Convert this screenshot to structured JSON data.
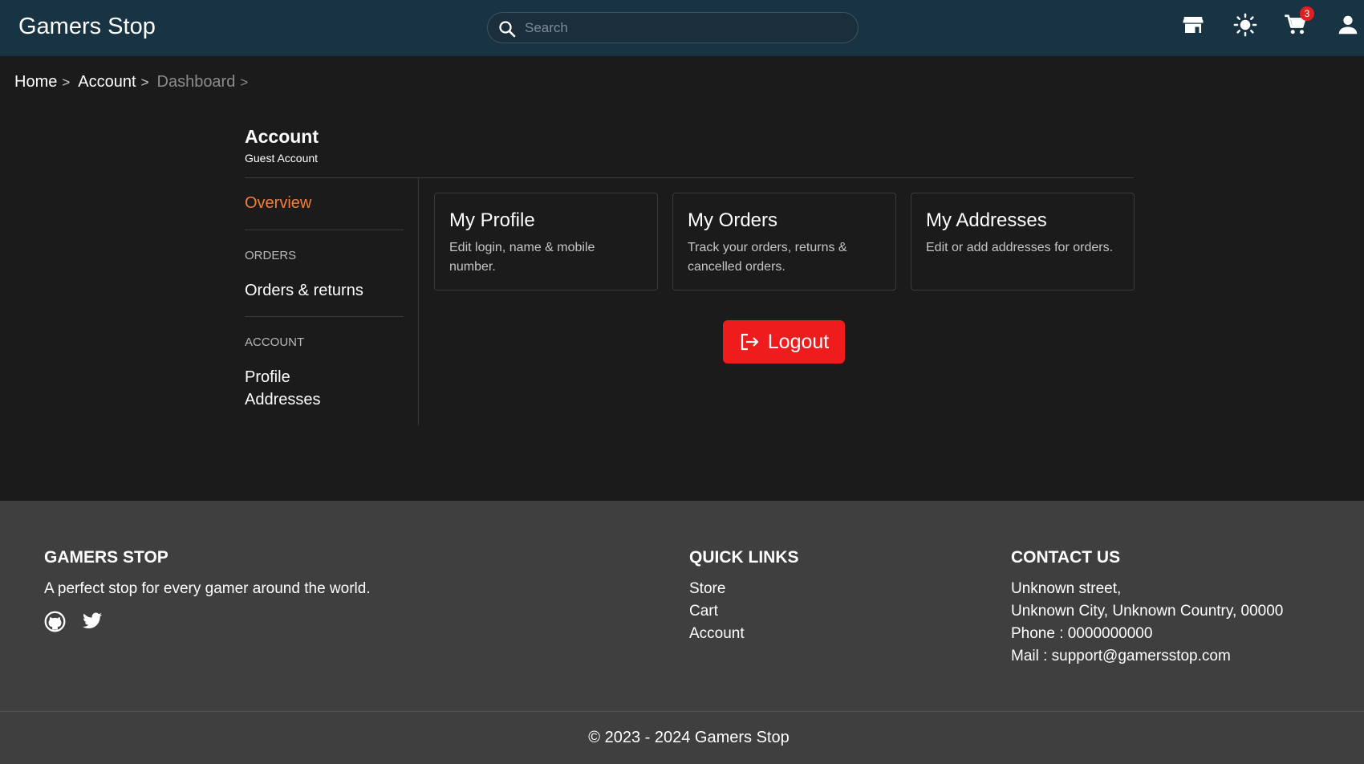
{
  "header": {
    "brand": "Gamers Stop",
    "search_placeholder": "Search",
    "cart_count": "3",
    "icons": [
      "store-icon",
      "theme-toggle-icon",
      "cart-icon",
      "user-icon"
    ]
  },
  "breadcrumb": {
    "items": [
      "Home",
      "Account",
      "Dashboard"
    ],
    "separator": ">"
  },
  "account": {
    "title": "Account",
    "subtitle": "Guest Account"
  },
  "sidebar": {
    "overview": "Overview",
    "orders_section": "ORDERS",
    "orders_link": "Orders & returns",
    "account_section": "ACCOUNT",
    "profile_link": "Profile",
    "addresses_link": "Addresses"
  },
  "cards": [
    {
      "title": "My Profile",
      "desc": "Edit login, name & mobile number."
    },
    {
      "title": "My Orders",
      "desc": "Track your orders, returns & cancelled orders."
    },
    {
      "title": "My Addresses",
      "desc": "Edit or add addresses for orders."
    }
  ],
  "logout_label": "Logout",
  "footer": {
    "brand_title": "GAMERS STOP",
    "tagline": "A perfect stop for every gamer around the world.",
    "quick_title": "QUICK LINKS",
    "quick_links": [
      "Store",
      "Cart",
      "Account"
    ],
    "contact_title": "CONTACT US",
    "contact_lines": [
      "Unknown street,",
      "Unknown City, Unknown Country, 00000",
      "Phone : 0000000000",
      "Mail : support@gamersstop.com"
    ],
    "copyright": "© 2023 - 2024 Gamers Stop"
  },
  "colors": {
    "header_bg": "#183443",
    "page_bg": "#1b1b1c",
    "footer_bg": "#3f3f40",
    "accent": "#f07f3c",
    "logout": "#ee1c1c",
    "badge": "#e02020"
  }
}
